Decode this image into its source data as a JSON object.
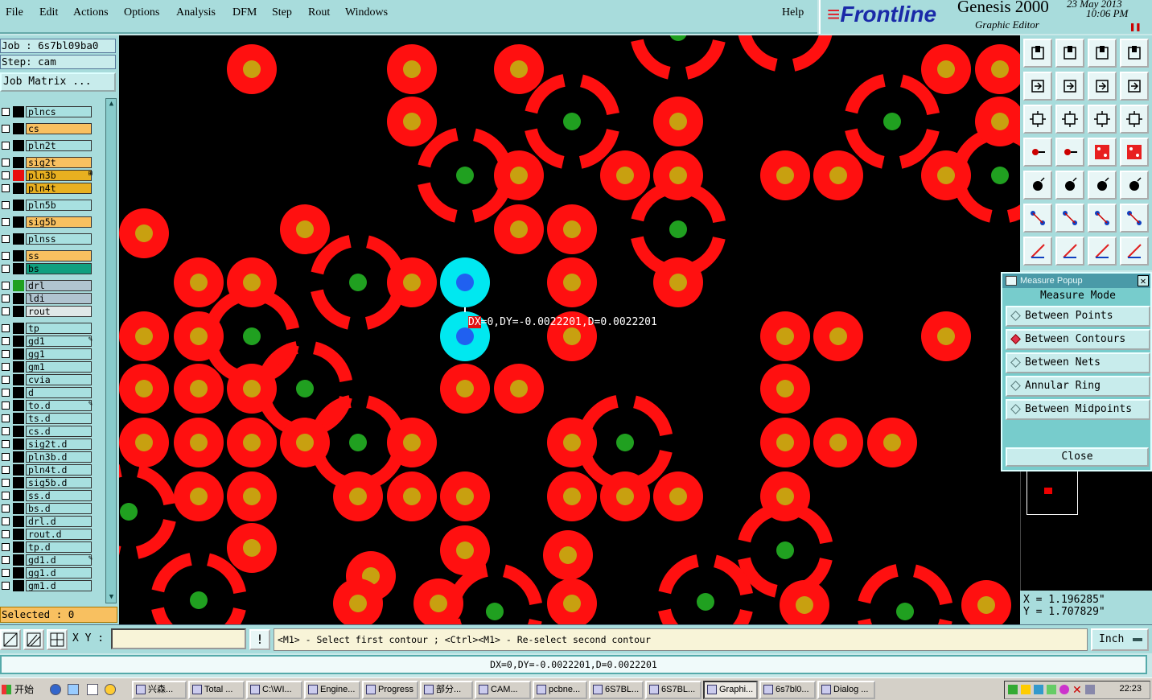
{
  "menu": {
    "items": [
      "File",
      "Edit",
      "Actions",
      "Options",
      "Analysis",
      "DFM",
      "Step",
      "Rout",
      "Windows"
    ],
    "help": "Help"
  },
  "brand": {
    "logo": "Frontline",
    "product": "Genesis 2000",
    "subtitle": "Graphic Editor",
    "date": "23 May 2013",
    "time": "10:06 PM"
  },
  "job": {
    "job_label": "Job : 6s7bl09ba0",
    "step_label": "Step: cam",
    "matrix_button": "Job Matrix ..."
  },
  "layers": [
    {
      "name": "plncs",
      "color": "#a8e0e0",
      "swatch": "#000"
    },
    {
      "name": "cs",
      "color": "#f8c060",
      "swatch": "#000"
    },
    {
      "name": "pln2t",
      "color": "#a8e0e0",
      "swatch": "#000"
    },
    {
      "name": "sig2t",
      "color": "#f8c060",
      "swatch": "#000"
    },
    {
      "name": "pln3b",
      "color": "#e8b020",
      "swatch": "#e81010",
      "flag": "⊞"
    },
    {
      "name": "pln4t",
      "color": "#e8b020",
      "swatch": "#000"
    },
    {
      "name": "pln5b",
      "color": "#a8e0e0",
      "swatch": "#000"
    },
    {
      "name": "sig5b",
      "color": "#f8c060",
      "swatch": "#000"
    },
    {
      "name": "plnss",
      "color": "#a8e0e0",
      "swatch": "#000"
    },
    {
      "name": "ss",
      "color": "#f8c060",
      "swatch": "#000"
    },
    {
      "name": "bs",
      "color": "#10a080",
      "swatch": "#000"
    },
    {
      "name": "drl",
      "color": "#b0c4d0",
      "swatch": "#20a020"
    },
    {
      "name": "ldi",
      "color": "#b0c4d0",
      "swatch": "#000"
    },
    {
      "name": "rout",
      "color": "#e0e8e8",
      "swatch": "#000"
    },
    {
      "name": "tp",
      "color": "#a8e0e0",
      "swatch": "#000"
    },
    {
      "name": "gd1",
      "color": "#a8e0e0",
      "swatch": "#000",
      "flag": "✎"
    },
    {
      "name": "gg1",
      "color": "#a8e0e0",
      "swatch": "#000"
    },
    {
      "name": "gm1",
      "color": "#a8e0e0",
      "swatch": "#000"
    },
    {
      "name": "cvia",
      "color": "#a8e0e0",
      "swatch": "#000"
    },
    {
      "name": "d",
      "color": "#a8e0e0",
      "swatch": "#000"
    },
    {
      "name": "to.d",
      "color": "#a8e0e0",
      "swatch": "#000",
      "flag": "✎"
    },
    {
      "name": "ts.d",
      "color": "#a8e0e0",
      "swatch": "#000"
    },
    {
      "name": "cs.d",
      "color": "#a8e0e0",
      "swatch": "#000"
    },
    {
      "name": "sig2t.d",
      "color": "#a8e0e0",
      "swatch": "#000"
    },
    {
      "name": "pln3b.d",
      "color": "#a8e0e0",
      "swatch": "#000"
    },
    {
      "name": "pln4t.d",
      "color": "#a8e0e0",
      "swatch": "#000"
    },
    {
      "name": "sig5b.d",
      "color": "#a8e0e0",
      "swatch": "#000"
    },
    {
      "name": "ss.d",
      "color": "#a8e0e0",
      "swatch": "#000"
    },
    {
      "name": "bs.d",
      "color": "#a8e0e0",
      "swatch": "#000"
    },
    {
      "name": "drl.d",
      "color": "#a8e0e0",
      "swatch": "#000"
    },
    {
      "name": "rout.d",
      "color": "#a8e0e0",
      "swatch": "#000"
    },
    {
      "name": "tp.d",
      "color": "#a8e0e0",
      "swatch": "#000"
    },
    {
      "name": "gd1.d",
      "color": "#a8e0e0",
      "swatch": "#000",
      "flag": "✎"
    },
    {
      "name": "gg1.d",
      "color": "#a8e0e0",
      "swatch": "#000"
    },
    {
      "name": "gm1.d",
      "color": "#a8e0e0",
      "swatch": "#000"
    }
  ],
  "selected_label": "Selected : 0",
  "canvas": {
    "measure_text_dx": "DX",
    "measure_text_rest": "=0,DY=-0.0022201,D=0.0022201",
    "colors": {
      "pad": "#ff1010",
      "hole": "#c8a010",
      "via_hole": "#20a020",
      "selected": "#00e8f0",
      "selected_hole": "#2060f0"
    }
  },
  "toolbox": {
    "icons": [
      "zoom-home-icon",
      "zoom-in-icon",
      "home-view-icon",
      "fit-window-icon",
      "pan-left-icon",
      "pan-right-icon",
      "redraw-icon",
      "snap-icon",
      "zoom-fit-icon",
      "center-icon",
      "scale-1to2-icon",
      "help-query-icon",
      "cursor-settings-icon",
      "measure-tool-icon",
      "drc-compare-icon",
      "drc-compare-alt-icon",
      "pad-select-icon",
      "polygon-select-icon",
      "ruler-icon",
      "circle-select-icon",
      "net-connect-icon",
      "cross-delete-icon",
      "line-node-icon",
      "line-node-alt-icon",
      "slash-edit-icon",
      "arrow-line-icon",
      "arc-icon",
      "mirror-flip-icon"
    ]
  },
  "popup": {
    "title": "Measure Popup",
    "heading": "Measure Mode",
    "modes": [
      {
        "label": "Between Points",
        "selected": false
      },
      {
        "label": "Between Contours",
        "selected": true
      },
      {
        "label": "Between Nets",
        "selected": false
      },
      {
        "label": "Annular Ring",
        "selected": false
      },
      {
        "label": "Between Midpoints",
        "selected": false
      }
    ],
    "close": "Close"
  },
  "coords": {
    "x": "X = 1.196285\"",
    "y": "Y = 1.707829\""
  },
  "status": {
    "xy_label": "X Y :",
    "xy_value": "",
    "bang": "!",
    "prompt": "<M1> - Select first contour ; <Ctrl><M1> - Re-select second contour",
    "unit": "Inch",
    "info": "DX=0,DY=-0.0022201,D=0.0022201"
  },
  "taskbar": {
    "start": "开始",
    "tasks": [
      {
        "label": "兴森...",
        "active": false
      },
      {
        "label": "Total ...",
        "active": false
      },
      {
        "label": "C:\\WI...",
        "active": false
      },
      {
        "label": "Engine...",
        "active": false
      },
      {
        "label": "Progress",
        "active": false
      },
      {
        "label": "部分...",
        "active": false
      },
      {
        "label": "CAM...",
        "active": false
      },
      {
        "label": "pcbne...",
        "active": false
      },
      {
        "label": "6S7BL...",
        "active": false
      },
      {
        "label": "6S7BL...",
        "active": false
      },
      {
        "label": "Graphi...",
        "active": true
      },
      {
        "label": "6s7bl0...",
        "active": false
      },
      {
        "label": "Dialog ...",
        "active": false
      }
    ],
    "clock": "22:23"
  }
}
